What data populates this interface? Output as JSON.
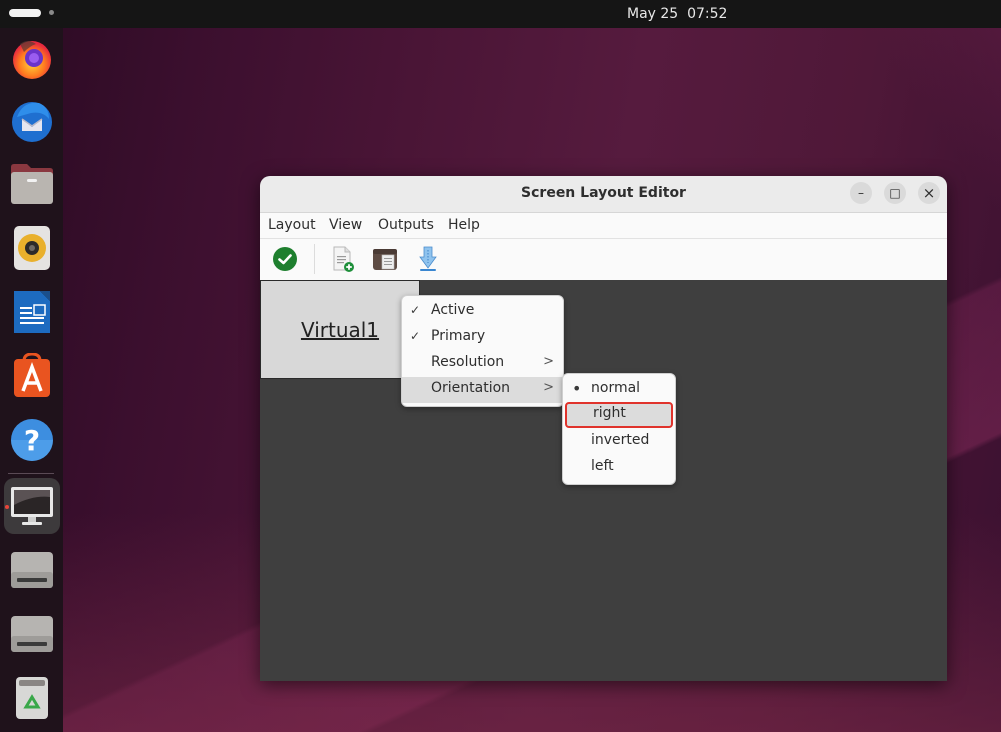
{
  "topbar": {
    "clock": "May 25  07:52"
  },
  "dock": {
    "items": [
      {
        "name": "firefox",
        "icon": "firefox-icon"
      },
      {
        "name": "thunderbird",
        "icon": "thunderbird-icon"
      },
      {
        "name": "files",
        "icon": "files-icon"
      },
      {
        "name": "rhythmbox",
        "icon": "rhythmbox-icon"
      },
      {
        "name": "libreoffice-writer",
        "icon": "writer-icon"
      },
      {
        "name": "app-center",
        "icon": "app-center-icon"
      },
      {
        "name": "help",
        "icon": "help-icon"
      },
      {
        "name": "screen-layout-editor",
        "icon": "monitor-icon",
        "active": true
      },
      {
        "name": "drive-1",
        "icon": "drive-icon"
      },
      {
        "name": "drive-2",
        "icon": "drive-icon"
      },
      {
        "name": "trash",
        "icon": "trash-icon"
      }
    ]
  },
  "window": {
    "title": "Screen Layout Editor",
    "controls": {
      "minimize": "–",
      "maximize": "□",
      "close": "×"
    },
    "menu": [
      "Layout",
      "View",
      "Outputs",
      "Help"
    ],
    "toolbar": [
      {
        "name": "apply",
        "icon": "check-circle-icon"
      },
      {
        "name": "new-layout",
        "icon": "new-document-icon"
      },
      {
        "name": "open-layout",
        "icon": "open-folder-icon"
      },
      {
        "name": "save-layout",
        "icon": "save-download-icon"
      }
    ],
    "monitor": {
      "name": "Virtual1"
    }
  },
  "context_menu": {
    "items": [
      {
        "label": "Active",
        "checked": true,
        "submenu": false
      },
      {
        "label": "Primary",
        "checked": true,
        "submenu": false
      },
      {
        "label": "Resolution",
        "checked": false,
        "submenu": true
      },
      {
        "label": "Orientation",
        "checked": false,
        "submenu": true,
        "highlighted": true
      }
    ],
    "check_glyph": "✓",
    "arrow_glyph": ">"
  },
  "orientation_menu": {
    "items": [
      {
        "label": "normal",
        "selected": true
      },
      {
        "label": "right",
        "selected": false,
        "highlighted": true
      },
      {
        "label": "inverted",
        "selected": false
      },
      {
        "label": "left",
        "selected": false
      }
    ],
    "selected_glyph": "•"
  },
  "colors": {
    "highlight_outline": "#e0332c",
    "apply_green": "#1e7f2e",
    "canvas_bg": "#3f3f3f"
  }
}
